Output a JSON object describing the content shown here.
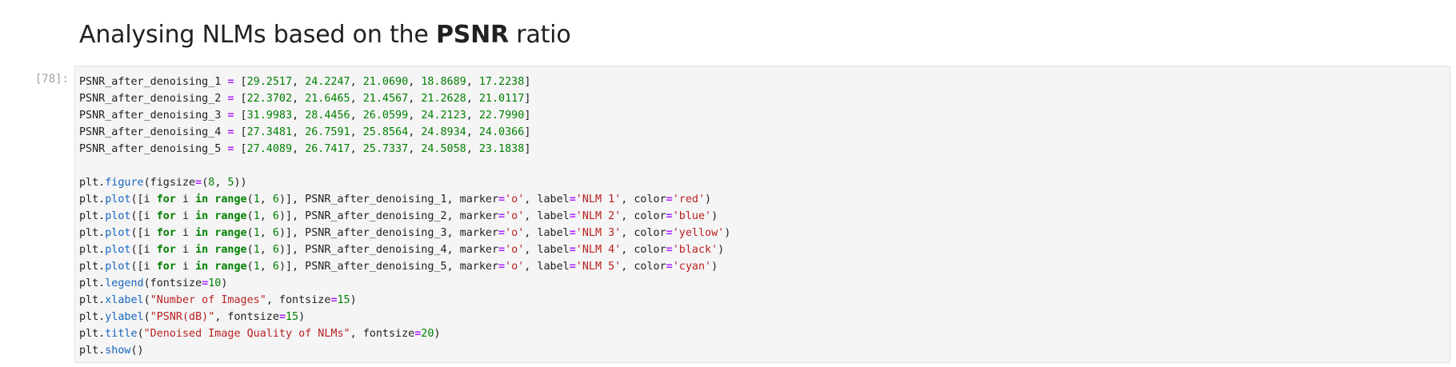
{
  "markdown": {
    "heading_pre": "Analysing NLMs based on the ",
    "heading_bold": "PSNR",
    "heading_post": " ratio"
  },
  "cell": {
    "prompt": "[78]:",
    "psnr_lists": [
      {
        "name": "PSNR_after_denoising_1",
        "values": [
          "29.2517",
          "24.2247",
          "21.0690",
          "18.8689",
          "17.2238"
        ]
      },
      {
        "name": "PSNR_after_denoising_2",
        "values": [
          "22.3702",
          "21.6465",
          "21.4567",
          "21.2628",
          "21.0117"
        ]
      },
      {
        "name": "PSNR_after_denoising_3",
        "values": [
          "31.9983",
          "28.4456",
          "26.0599",
          "24.2123",
          "22.7990"
        ]
      },
      {
        "name": "PSNR_after_denoising_4",
        "values": [
          "27.3481",
          "26.7591",
          "25.8564",
          "24.8934",
          "24.0366"
        ]
      },
      {
        "name": "PSNR_after_denoising_5",
        "values": [
          "27.4089",
          "26.7417",
          "25.7337",
          "24.5058",
          "23.1838"
        ]
      }
    ],
    "figure_line": {
      "obj": "plt",
      "fn": "figure",
      "arg": "figsize",
      "w": "8",
      "h": "5"
    },
    "plot_calls": [
      {
        "series": "PSNR_after_denoising_1",
        "marker": "'o'",
        "label": "'NLM 1'",
        "color": "'red'"
      },
      {
        "series": "PSNR_after_denoising_2",
        "marker": "'o'",
        "label": "'NLM 2'",
        "color": "'blue'"
      },
      {
        "series": "PSNR_after_denoising_3",
        "marker": "'o'",
        "label": "'NLM 3'",
        "color": "'yellow'"
      },
      {
        "series": "PSNR_after_denoising_4",
        "marker": "'o'",
        "label": "'NLM 4'",
        "color": "'black'"
      },
      {
        "series": "PSNR_after_denoising_5",
        "marker": "'o'",
        "label": "'NLM 5'",
        "color": "'cyan'"
      }
    ],
    "range_start": "1",
    "range_end": "6",
    "legend_fontsize": "10",
    "xlabel": "\"Number of Images\"",
    "xlabel_fontsize": "15",
    "ylabel": "\"PSNR(dB)\"",
    "ylabel_fontsize": "15",
    "title": "\"Denoised Image Quality of NLMs\"",
    "title_fontsize": "20"
  }
}
